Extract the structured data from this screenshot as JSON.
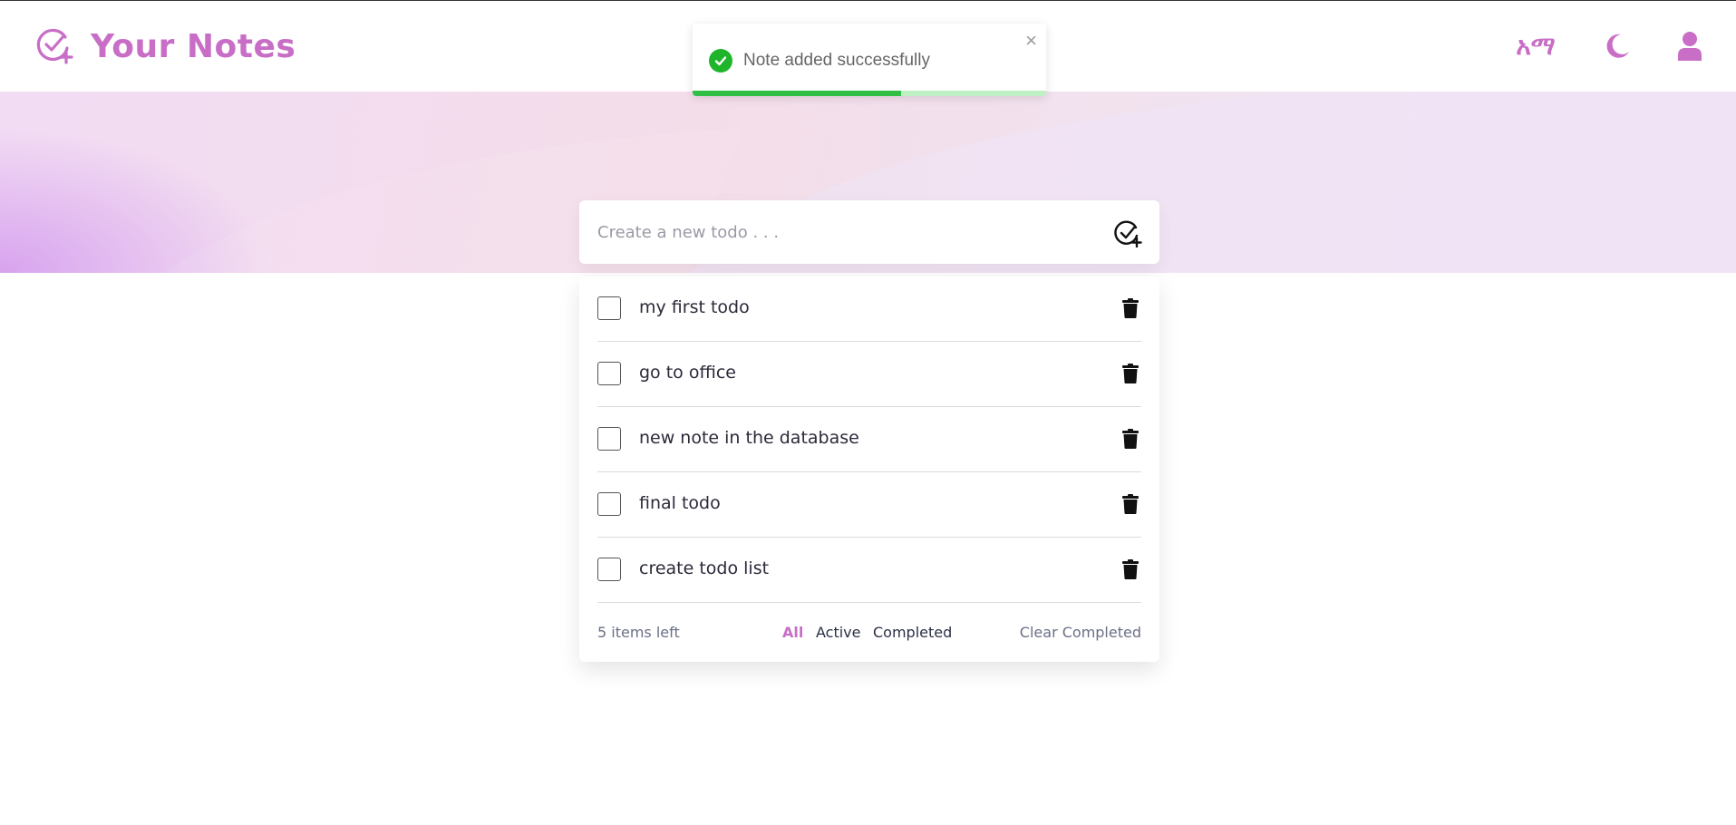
{
  "colors": {
    "accent": "#c86ec6",
    "success": "#1fb52b",
    "text": "#2a2a3a"
  },
  "header": {
    "title": "Your Notes",
    "logo_icon": "check-plus-icon",
    "language_label": "አማ",
    "theme_icon": "moon-icon",
    "user_icon": "user-icon"
  },
  "toast": {
    "message": "Note added successfully",
    "close_label": "×",
    "progress": 0.59
  },
  "new_todo": {
    "placeholder": "Create a new todo . . ."
  },
  "todos": [
    {
      "text": "my first todo",
      "completed": false
    },
    {
      "text": "go to office",
      "completed": false
    },
    {
      "text": "new note in the database",
      "completed": false
    },
    {
      "text": "final todo",
      "completed": false
    },
    {
      "text": "create todo list",
      "completed": false
    }
  ],
  "footer": {
    "items_left": "5 items left",
    "filter_all": "All",
    "filter_active": "Active",
    "filter_completed": "Completed",
    "active_filter": "All",
    "clear_completed": "Clear Completed"
  }
}
